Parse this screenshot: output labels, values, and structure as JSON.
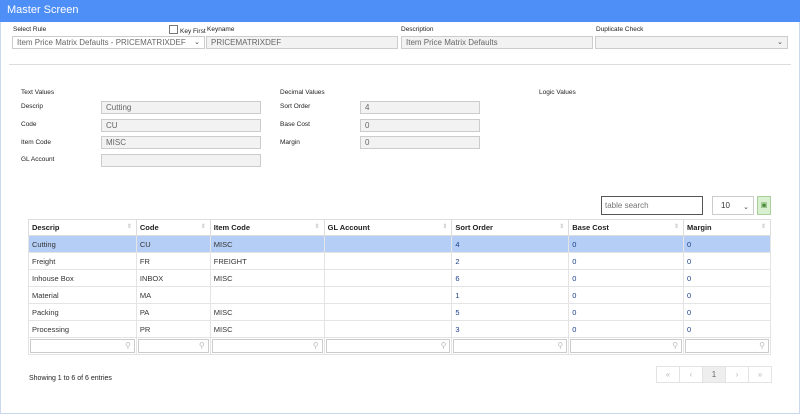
{
  "title": "Master Screen",
  "top": {
    "select_rule_label": "Select Rule",
    "select_rule_value": "Item Price Matrix Defaults - PRICEMATRIXDEF",
    "key_first_label": "Key First",
    "keyname_label": "Keyname",
    "keyname_value": "PRICEMATRIXDEF",
    "description_label": "Description",
    "description_value": "Item Price Matrix Defaults",
    "duplicate_label": "Duplicate Check",
    "duplicate_value": ""
  },
  "sections": {
    "text": "Text Values",
    "decimal": "Decimal Values",
    "logic": "Logic Values"
  },
  "text_fields": [
    {
      "label": "Descrip",
      "value": "Cutting"
    },
    {
      "label": "Code",
      "value": "CU"
    },
    {
      "label": "Item Code",
      "value": "MISC"
    },
    {
      "label": "GL Account",
      "value": ""
    }
  ],
  "decimal_fields": [
    {
      "label": "Sort Order",
      "value": "4"
    },
    {
      "label": "Base Cost",
      "value": "0"
    },
    {
      "label": "Margin",
      "value": "0"
    }
  ],
  "table": {
    "search_placeholder": "table search",
    "page_size": "10",
    "columns": [
      "Descrip",
      "Code",
      "Item Code",
      "GL Account",
      "Sort Order",
      "Base Cost",
      "Margin"
    ],
    "rows": [
      [
        "Cutting",
        "CU",
        "MISC",
        "",
        "4",
        "0",
        "0"
      ],
      [
        "Freight",
        "FR",
        "FREIGHT",
        "",
        "2",
        "0",
        "0"
      ],
      [
        "Inhouse Box",
        "INBOX",
        "MISC",
        "",
        "6",
        "0",
        "0"
      ],
      [
        "Material",
        "MA",
        "",
        "",
        "1",
        "0",
        "0"
      ],
      [
        "Packing",
        "PA",
        "MISC",
        "",
        "5",
        "0",
        "0"
      ],
      [
        "Processing",
        "PR",
        "MISC",
        "",
        "3",
        "0",
        "0"
      ]
    ],
    "info": "Showing 1 to 6 of 6 entries",
    "pager": [
      "«",
      "‹",
      "1",
      "›",
      "»"
    ]
  }
}
